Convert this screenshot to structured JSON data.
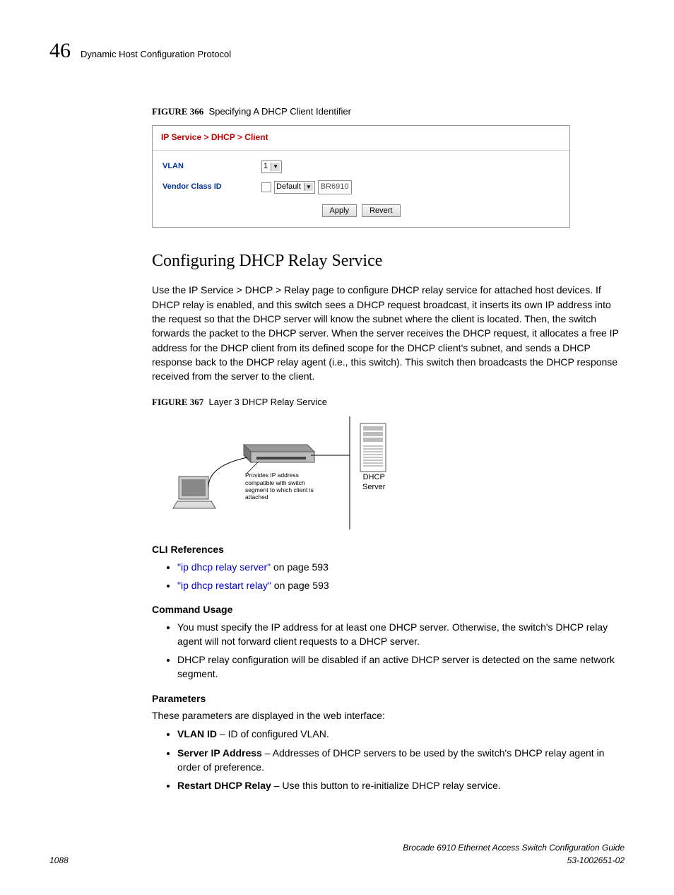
{
  "header": {
    "page_number_top": "46",
    "chapter_title": "Dynamic Host Configuration Protocol"
  },
  "figure366": {
    "label": "FIGURE 366",
    "caption": "Specifying A DHCP Client Identifier",
    "breadcrumb": "IP Service > DHCP > Client",
    "vlan_label": "VLAN",
    "vlan_value": "1",
    "vendor_label": "Vendor Class ID",
    "vendor_dropdown": "Default",
    "vendor_text": "BR6910",
    "apply": "Apply",
    "revert": "Revert"
  },
  "section_heading": "Configuring DHCP Relay Service",
  "intro_paragraph": "Use the IP Service > DHCP > Relay page to configure DHCP relay service for attached host devices. If DHCP relay is enabled, and this switch sees a DHCP request broadcast, it inserts its own IP address into the request so that the DHCP server will know the subnet where the client is located. Then, the switch forwards the packet to the DHCP server. When the server receives the DHCP request, it allocates a free IP address for the DHCP client from its defined scope for the DHCP client's subnet, and sends a DHCP response back to the DHCP relay agent (i.e., this switch). This switch then broadcasts the DHCP response received from the server to the client.",
  "figure367": {
    "label": "FIGURE 367",
    "caption": "Layer 3 DHCP Relay Service",
    "annotation": "Provides IP address compatible with switch segment to which client is attached",
    "server_label_1": "DHCP",
    "server_label_2": "Server"
  },
  "cli_refs_heading": "CLI References",
  "cli_refs": [
    {
      "link": "\"ip dhcp relay server\"",
      "suffix": " on page 593"
    },
    {
      "link": "\"ip dhcp restart relay\"",
      "suffix": " on page 593"
    }
  ],
  "command_usage_heading": "Command Usage",
  "command_usage": [
    "You must specify the IP address for at least one DHCP server. Otherwise, the switch's DHCP relay agent will not forward client requests to a DHCP server.",
    "DHCP relay configuration will be disabled if an active DHCP server is detected on the same network segment."
  ],
  "parameters_heading": "Parameters",
  "parameters_intro": "These parameters are displayed in the web interface:",
  "parameters": [
    {
      "name": "VLAN ID",
      "desc": " – ID of configured VLAN."
    },
    {
      "name": "Server IP Address",
      "desc": " – Addresses of DHCP servers to be used by the switch's DHCP relay agent in order of preference."
    },
    {
      "name": "Restart DHCP Relay",
      "desc": " – Use this button to re-initialize DHCP relay service."
    }
  ],
  "footer": {
    "page": "1088",
    "line1": "Brocade 6910 Ethernet Access Switch Configuration Guide",
    "line2": "53-1002651-02"
  }
}
